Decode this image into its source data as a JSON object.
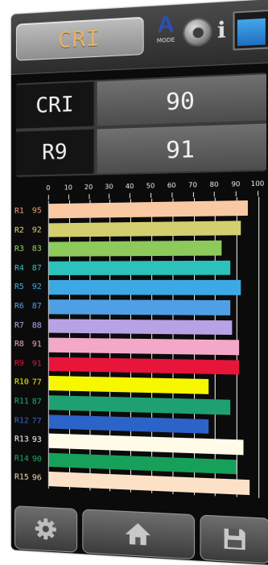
{
  "header": {
    "title": "CRI",
    "mode_letter": "A",
    "mode_label": "MODE",
    "info_label": "i"
  },
  "readout": [
    {
      "label": "CRI",
      "value": "90"
    },
    {
      "label": "R9",
      "value": "91"
    }
  ],
  "chart_data": {
    "type": "bar",
    "orientation": "horizontal",
    "x_ticks": [
      "0",
      "10",
      "20",
      "30",
      "40",
      "50",
      "60",
      "70",
      "80",
      "90",
      "100"
    ],
    "xlim": [
      0,
      100
    ],
    "categories": [
      "R1",
      "R2",
      "R3",
      "R4",
      "R5",
      "R6",
      "R7",
      "R8",
      "R9",
      "R10",
      "R11",
      "R12",
      "R13",
      "R14",
      "R15"
    ],
    "values": [
      95,
      92,
      83,
      87,
      92,
      87,
      88,
      91,
      91,
      77,
      87,
      77,
      93,
      90,
      96
    ],
    "colors": [
      "#f9c9a4",
      "#d4cf6e",
      "#8dc95b",
      "#2bc2bb",
      "#3da8e6",
      "#4f9fe6",
      "#b7a2e6",
      "#f4a8c8",
      "#e8143a",
      "#f7f700",
      "#1fa071",
      "#2c63c8",
      "#fffbe8",
      "#16a05a",
      "#fde1c6"
    ],
    "label_colors": [
      "#f0a07a",
      "#e8d86a",
      "#9bd468",
      "#2ec8c0",
      "#3ab0ee",
      "#56a4f0",
      "#c0a8f0",
      "#f6a8c8",
      "#e8143a",
      "#f7f700",
      "#23b07a",
      "#3469d6",
      "#ffffff",
      "#18b062",
      "#ffd8b4"
    ],
    "grid": true
  },
  "footer": {
    "settings_icon": "gear-icon",
    "home_icon": "home-icon",
    "save_icon": "save-icon"
  }
}
